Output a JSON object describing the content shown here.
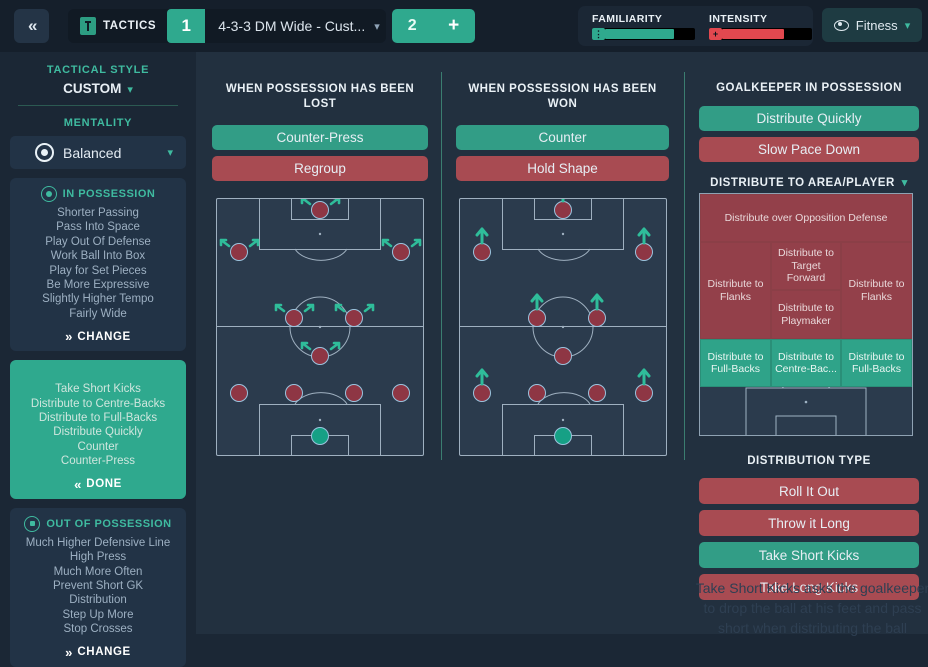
{
  "topbar": {
    "back_icon": "chevron-left-icon",
    "tactics_label": "TACTICS",
    "tactic_number": "1",
    "formation_name": "4-3-3 DM Wide - Cust...",
    "formation_caret": "⌄",
    "second_tactic_number": "2",
    "add_label": "+",
    "familiarity": {
      "label": "FAMILIARITY",
      "fill_percent": 78,
      "color": "#2fa98e",
      "tip_icon": "familiarity-icon"
    },
    "intensity": {
      "label": "INTENSITY",
      "fill_percent": 70,
      "color": "#e2484f",
      "tip_icon": "plus-icon"
    },
    "fitness_button": {
      "label": "Fitness",
      "icon": "eye-icon",
      "caret": "⌄"
    }
  },
  "sidebar": {
    "tactical_style_title": "TACTICAL STYLE",
    "tactical_style_value": "CUSTOM",
    "tactical_style_caret": "⌄",
    "mentality_title": "MENTALITY",
    "mentality_value": "Balanced",
    "mentality_caret": "⌄",
    "in_possession": {
      "title": "IN POSSESSION",
      "icon": "possession-icon",
      "instructions": [
        "Shorter Passing",
        "Pass Into Space",
        "Play Out Of Defense",
        "Work Ball Into Box",
        "Play for Set Pieces",
        "Be More Expressive",
        "Slightly Higher Tempo",
        "Fairly Wide"
      ],
      "footer_label": "CHANGE",
      "footer_icon": "double-chevron-right-icon"
    },
    "transition": {
      "instructions": [
        "Take Short Kicks",
        "Distribute to Centre-Backs",
        "Distribute to Full-Backs",
        "Distribute Quickly",
        "Counter",
        "Counter-Press"
      ],
      "footer_label": "DONE",
      "footer_icon": "double-chevron-left-icon"
    },
    "out_of_possession": {
      "title": "OUT OF POSSESSION",
      "icon": "defense-icon",
      "instructions": [
        "Much Higher Defensive Line",
        "High Press",
        "Much More Often",
        "Prevent Short GK",
        "Distribution",
        "Step Up More",
        "Stop Crosses"
      ],
      "footer_label": "CHANGE",
      "footer_icon": "double-chevron-right-icon"
    }
  },
  "possession_lost": {
    "title": "WHEN POSSESSION HAS BEEN LOST",
    "options": [
      {
        "label": "Counter-Press",
        "selected": true
      },
      {
        "label": "Regroup",
        "selected": false
      }
    ]
  },
  "possession_won": {
    "title": "WHEN POSSESSION HAS BEEN WON",
    "options": [
      {
        "label": "Counter",
        "selected": true
      },
      {
        "label": "Hold Shape",
        "selected": false
      }
    ]
  },
  "goalkeeper": {
    "title": "GOALKEEPER IN POSSESSION",
    "options": [
      {
        "label": "Distribute Quickly",
        "selected": true
      },
      {
        "label": "Slow Pace Down",
        "selected": false
      }
    ],
    "distribute_area_title": "DISTRIBUTE TO AREA/PLAYER",
    "distribute_area_caret": "⌄",
    "zones": [
      {
        "label": "Distribute over Opposition Defense",
        "selected": false
      },
      {
        "label": "Distribute to Target Forward",
        "selected": false
      },
      {
        "label": "Distribute to Flanks",
        "selected": false
      },
      {
        "label": "Distribute to Flanks",
        "selected": false
      },
      {
        "label": "Distribute to Playmaker",
        "selected": false
      },
      {
        "label": "Distribute to Full-Backs",
        "selected": true
      },
      {
        "label": "Distribute to Centre-Bac...",
        "selected": true
      },
      {
        "label": "Distribute to Full-Backs",
        "selected": true
      }
    ],
    "distribution_type_title": "DISTRIBUTION TYPE",
    "distribution_types": [
      {
        "label": "Roll It Out",
        "selected": false
      },
      {
        "label": "Throw it Long",
        "selected": false
      },
      {
        "label": "Take Short Kicks",
        "selected": true
      },
      {
        "label": "Take Long Kicks",
        "selected": false
      }
    ]
  },
  "tooltip": {
    "line1": "Take Short Kicks asks the goalkeeper",
    "line2": "to drop the ball at his feet and pass",
    "line3": "short when distributing the ball"
  },
  "colors": {
    "selected": "#329d86",
    "unselected": "#a84b52",
    "accent": "#3fbba0",
    "background": "#22303f"
  }
}
